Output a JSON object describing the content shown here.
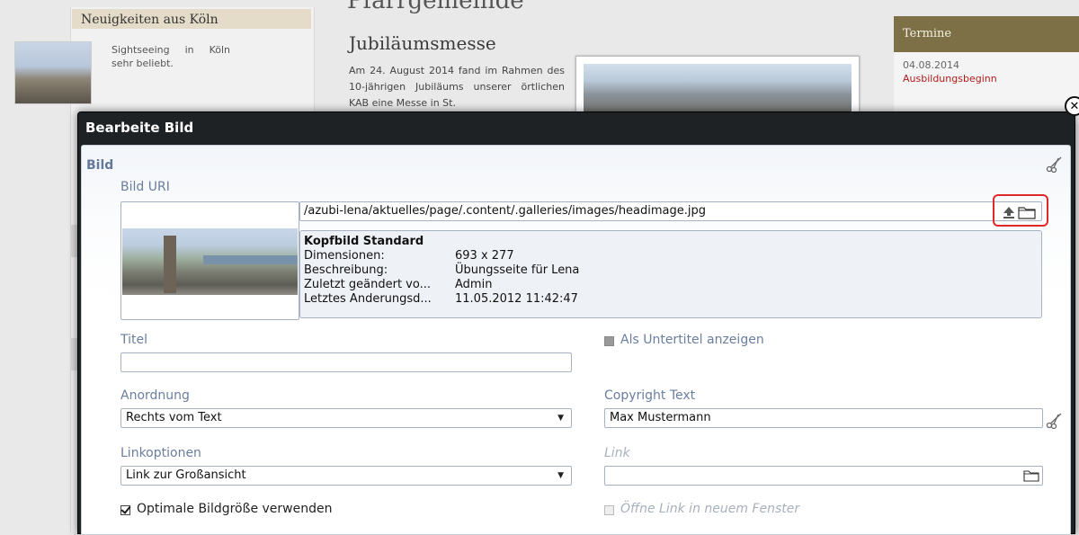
{
  "background": {
    "news_header": "Neuigkeiten aus Köln",
    "news_text": "Sightseeing in Köln sehr beliebt.",
    "page_title_partial": "Pfarrgemeinde",
    "article_title": "Jubiläumsmesse",
    "article_text": "Am 24. August 2014 fand im Rahmen des 10-jährigen Jubiläums unserer örtlichen KAB eine Messe in St.",
    "termine_header": "Termine",
    "termine_date": "04.08.2014",
    "termine_link": "Ausbildungsbeginn"
  },
  "dialog": {
    "title": "Bearbeite Bild",
    "section_title": "Bild",
    "uri_label": "Bild URI",
    "uri_value": "/azubi-lena/aktuelles/page/.content/.galleries/images/headimage.jpg",
    "info": {
      "title": "Kopfbild Standard",
      "rows": [
        {
          "key": "Dimensionen:",
          "value": "693 x 277"
        },
        {
          "key": "Beschreibung:",
          "value": "Übungsseite für Lena"
        },
        {
          "key": "Zuletzt geändert vo...",
          "value": "Admin"
        },
        {
          "key": "Letztes Änderungsd...",
          "value": "11.05.2012 11:42:47"
        }
      ]
    },
    "titel_label": "Titel",
    "titel_value": "",
    "subtitle_checkbox_label": "Als Untertitel anzeigen",
    "anordnung_label": "Anordnung",
    "anordnung_value": "Rechts vom Text",
    "copyright_label": "Copyright Text",
    "copyright_value": "Max Mustermann",
    "linkoptionen_label": "Linkoptionen",
    "linkoptionen_value": "Link zur Großansicht",
    "link_label": "Link",
    "link_value": "",
    "optimal_checkbox_label": "Optimale Bildgröße verwenden",
    "optimal_checked": true,
    "new_window_checkbox_label": "Öffne Link in neuem Fenster"
  },
  "icons": {
    "close": "close-icon",
    "scissors": "scissors-icon",
    "upload": "upload-icon",
    "folder": "folder-icon",
    "caret": "chevron-down-icon"
  },
  "colors": {
    "dialog_header": "#1f2225",
    "label_blue": "#6a7e9e",
    "highlight_red": "#e12828",
    "termine_header": "#7d7047",
    "termine_link": "#b01c1c"
  }
}
